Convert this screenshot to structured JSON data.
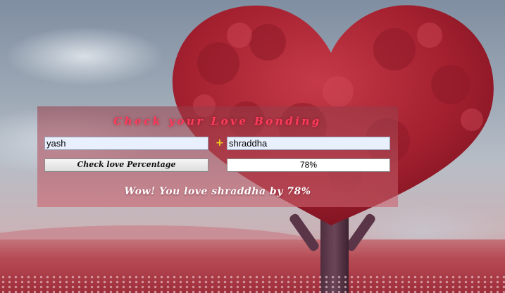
{
  "app": {
    "title": "Check your Love Bonding",
    "plus_symbol": "+",
    "button_label": "Check love Percentage",
    "result_value": "78%",
    "message": "Wow! You love shraddha by 78%"
  },
  "inputs": {
    "first_name": "yash",
    "second_name": "shraddha"
  },
  "colors": {
    "title": "#ff3b5c",
    "plus": "#f2d21b",
    "panel": "#b9556a",
    "tree": "#a8202e"
  }
}
